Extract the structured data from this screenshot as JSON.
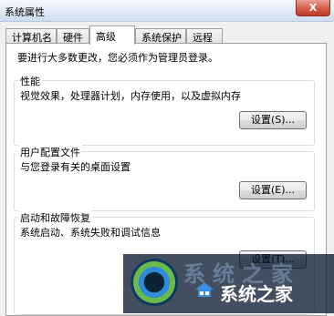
{
  "window": {
    "title": "系统属性",
    "close_label": "X"
  },
  "tabs": [
    {
      "label": "计算机名"
    },
    {
      "label": "硬件"
    },
    {
      "label": "高级"
    },
    {
      "label": "系统保护"
    },
    {
      "label": "远程"
    }
  ],
  "active_tab": "高级",
  "intro": "要进行大多数更改，您必须作为管理员登录。",
  "groups": [
    {
      "title": "性能",
      "description": "视觉效果，处理器计划，内存使用，以及虚拟内存",
      "button": "设置(S)..."
    },
    {
      "title": "用户配置文件",
      "description": "与您登录有关的桌面设置",
      "button": "设置(E)..."
    },
    {
      "title": "启动和故障恢复",
      "description": "系统启动、系统失败和调试信息",
      "button": "设置(T)..."
    }
  ],
  "watermark": {
    "text": "系统之家",
    "ghost_text": "系统之家"
  }
}
